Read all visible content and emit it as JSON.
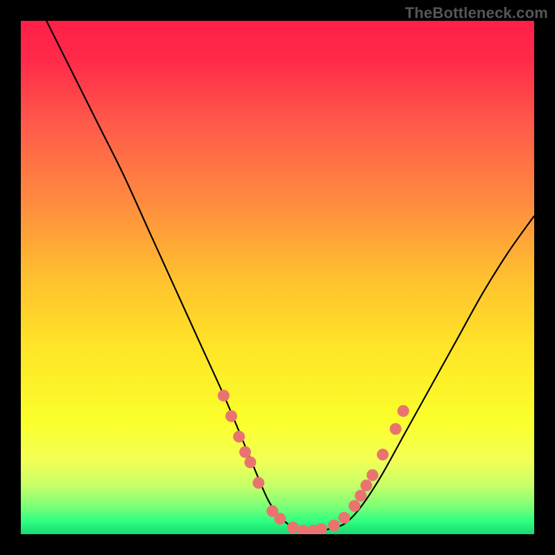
{
  "watermark": "TheBottleneck.com",
  "colors": {
    "frame": "#000000",
    "curve_stroke": "#000000",
    "dot_fill": "#e9746f",
    "gradient_stops": [
      {
        "offset": 0.0,
        "color": "#ff1f47"
      },
      {
        "offset": 0.08,
        "color": "#ff2b4a"
      },
      {
        "offset": 0.2,
        "color": "#ff5a4a"
      },
      {
        "offset": 0.35,
        "color": "#ff8a3f"
      },
      {
        "offset": 0.5,
        "color": "#ffc02f"
      },
      {
        "offset": 0.63,
        "color": "#ffe327"
      },
      {
        "offset": 0.78,
        "color": "#faff2b"
      },
      {
        "offset": 0.855,
        "color": "#f3ff55"
      },
      {
        "offset": 0.905,
        "color": "#c7ff68"
      },
      {
        "offset": 0.945,
        "color": "#7dff76"
      },
      {
        "offset": 0.975,
        "color": "#2eff80"
      },
      {
        "offset": 1.0,
        "color": "#18d878"
      }
    ]
  },
  "chart_data": {
    "type": "line",
    "title": "",
    "xlabel": "",
    "ylabel": "",
    "xlim": [
      0,
      100
    ],
    "ylim": [
      0,
      100
    ],
    "grid": false,
    "series": [
      {
        "name": "bottleneck-curve",
        "x": [
          5,
          10,
          15,
          20,
          25,
          30,
          35,
          40,
          45,
          48,
          50,
          52,
          54,
          56,
          58,
          60,
          63,
          66,
          70,
          75,
          80,
          85,
          90,
          95,
          100
        ],
        "y": [
          100,
          90,
          80,
          70,
          59,
          48,
          37,
          26,
          14,
          7,
          4,
          2,
          1,
          0.5,
          0.5,
          1,
          2,
          5,
          11,
          20,
          29,
          38,
          47,
          55,
          62
        ]
      }
    ],
    "dots": [
      {
        "x": 39.5,
        "y": 27
      },
      {
        "x": 41.0,
        "y": 23
      },
      {
        "x": 42.5,
        "y": 19
      },
      {
        "x": 43.7,
        "y": 16
      },
      {
        "x": 44.7,
        "y": 14
      },
      {
        "x": 46.3,
        "y": 10
      },
      {
        "x": 49.0,
        "y": 4.5
      },
      {
        "x": 50.5,
        "y": 3
      },
      {
        "x": 53.0,
        "y": 1.3
      },
      {
        "x": 55.0,
        "y": 0.7
      },
      {
        "x": 57.0,
        "y": 0.7
      },
      {
        "x": 58.5,
        "y": 1.0
      },
      {
        "x": 61.0,
        "y": 1.7
      },
      {
        "x": 63.0,
        "y": 3.2
      },
      {
        "x": 65.0,
        "y": 5.5
      },
      {
        "x": 66.2,
        "y": 7.5
      },
      {
        "x": 67.3,
        "y": 9.5
      },
      {
        "x": 68.5,
        "y": 11.5
      },
      {
        "x": 70.5,
        "y": 15.5
      },
      {
        "x": 73.0,
        "y": 20.5
      },
      {
        "x": 74.5,
        "y": 24.0
      }
    ],
    "dot_radius_px": 8.5
  }
}
